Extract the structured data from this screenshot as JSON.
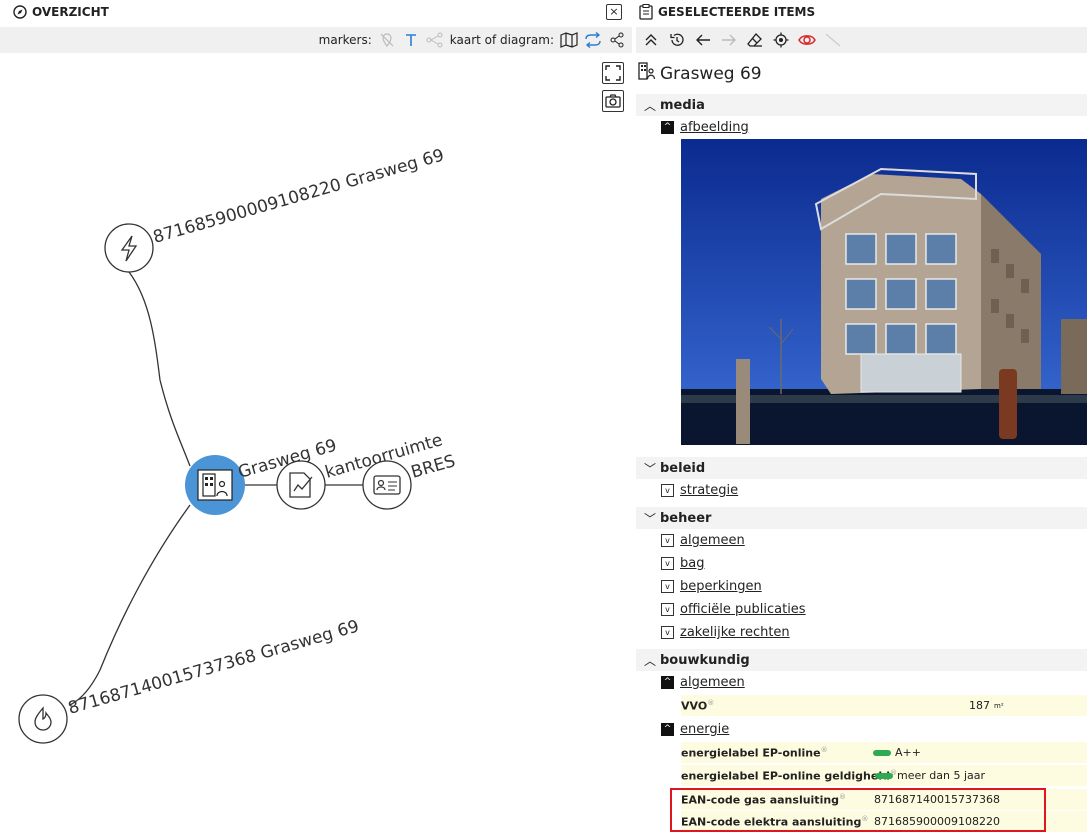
{
  "left_panel": {
    "title": "OVERZICHT",
    "close_label": "×",
    "toolbar": {
      "markers_label": "markers:",
      "mode_label": "kaart of diagram:"
    }
  },
  "graph": {
    "nodes": {
      "elektra": "871685900009108220 Grasweg 69",
      "gas": "871687140015737368 Grasweg 69",
      "main": "Grasweg 69",
      "kantoor": "kantoorruimte",
      "bres": "BRES"
    }
  },
  "right_panel": {
    "title": "GESELECTEERDE ITEMS",
    "item_title": "Grasweg 69",
    "sections": {
      "media": "media",
      "beleid": "beleid",
      "beheer": "beheer",
      "bouwkundig": "bouwkundig"
    },
    "links": {
      "afbeelding": "afbeelding",
      "strategie": "strategie",
      "algemeen_beheer": "algemeen",
      "bag": "bag",
      "beperkingen": "beperkingen",
      "officiele": "officiële publicaties",
      "zakelijke": "zakelijke rechten",
      "algemeen_bouw": "algemeen",
      "energie": "energie"
    },
    "rows": {
      "vvo_label": "VVO",
      "vvo_value": "187",
      "vvo_unit": "m²",
      "label_ep": "energielabel EP-online",
      "label_ep_value": "A++",
      "label_geld": "energielabel EP-online geldigheid",
      "label_geld_value": "meer dan 5 jaar",
      "ean_gas": "EAN-code gas aansluiting",
      "ean_gas_value": "871687140015737368",
      "ean_elek": "EAN-code elektra aansluiting",
      "ean_elek_value": "871685900009108220"
    }
  },
  "colors": {
    "accent": "#4b95d6",
    "highlight": "#e0151d",
    "row_bg": "#fdfbe0",
    "sync_icon": "#2a7fd0"
  }
}
